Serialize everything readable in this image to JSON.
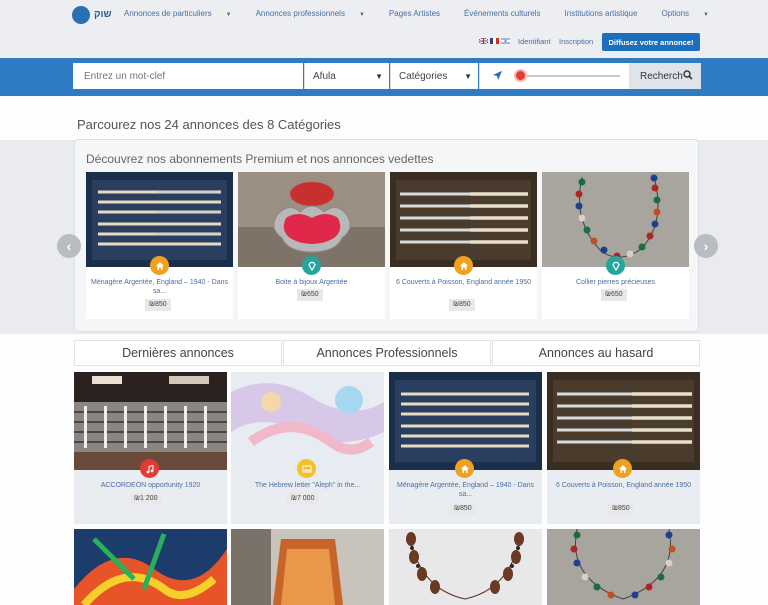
{
  "brand": {
    "logo_text": "שוק"
  },
  "nav": {
    "items": [
      {
        "label": "Annonces de particuliers",
        "dropdown": true
      },
      {
        "label": "Annonces professionnels",
        "dropdown": true
      },
      {
        "label": "Pages Artistes",
        "dropdown": false
      },
      {
        "label": "Événements culturels",
        "dropdown": false
      },
      {
        "label": "Institutions artistique",
        "dropdown": false
      },
      {
        "label": "Options",
        "dropdown": true
      }
    ],
    "login": "Identifiant",
    "register": "Inscription",
    "post_button": "Diffusez votre annonce!"
  },
  "search": {
    "placeholder": "Entrez un mot-clef",
    "location": "Afula",
    "category": "Catégories",
    "button": "Recherch",
    "distance_fraction": 0.0
  },
  "browse_title": "Parcourez nos 24 annonces des 8 Catégories",
  "premium": {
    "title": "Découvrez nos abonnements Premium et nos annonces vedettes",
    "cards": [
      {
        "title": "Ménagère Argentée, England – 1940 - Dans sa...",
        "price": "₪850",
        "icon": "home-icon",
        "badge_color": "#f0a020"
      },
      {
        "title": "Boite à bijoux Argentée",
        "price": "₪650",
        "icon": "diamond-icon",
        "badge_color": "#26a69a"
      },
      {
        "title": "6 Couverts à Poisson, England année 1950",
        "price": "₪850",
        "icon": "home-icon",
        "badge_color": "#f0a020"
      },
      {
        "title": "Collier pierres précieuses",
        "price": "₪650",
        "icon": "diamond-icon",
        "badge_color": "#26a69a"
      }
    ]
  },
  "tabs": [
    "Dernières annonces",
    "Annonces Professionnels",
    "Annonces au hasard"
  ],
  "listings": [
    {
      "title": "ACCORDEON opportunity 1920",
      "price": "₪1 200",
      "icon": "music-icon",
      "badge_color": "#e53935"
    },
    {
      "title": "The Hebrew letter \"Aleph\" in the...",
      "price": "₪7 000",
      "icon": "image-icon",
      "badge_color": "#f6c026"
    },
    {
      "title": "Ménagère Argentée, England – 1940 - Dans sa...",
      "price": "₪850",
      "icon": "home-icon",
      "badge_color": "#f0a020"
    },
    {
      "title": "6 Couverts à Poisson, England année 1950",
      "price": "₪850",
      "icon": "home-icon",
      "badge_color": "#f0a020"
    }
  ],
  "colors": {
    "accent": "#1b6fbd",
    "band": "#2d7cc4",
    "link": "#4a6ea3"
  }
}
